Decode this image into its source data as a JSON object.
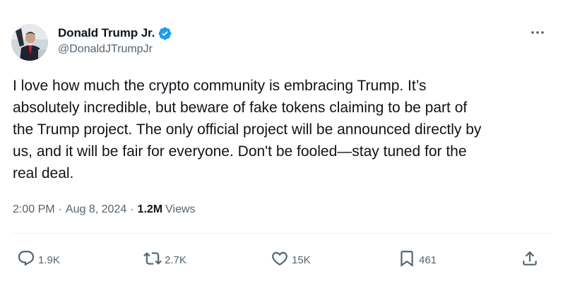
{
  "author": {
    "display_name": "Donald Trump Jr.",
    "handle": "@DonaldJTrumpJr",
    "verified_color": "#1d9bf0"
  },
  "tweet": {
    "text": "I love how much the crypto community is embracing Trump. It’s\nabsolutely incredible, but beware of fake tokens claiming to be part of\nthe Trump project. The only official project will be announced directly by\nus, and it will be fair for everyone. Don't be fooled—stay tuned for the\nreal deal."
  },
  "meta": {
    "time": "2:00 PM",
    "date": "Aug 8, 2024",
    "dot1": "·",
    "dot2": "·",
    "views_count": "1.2M",
    "views_label": "Views"
  },
  "actions": {
    "replies": "1.9K",
    "reposts": "2.7K",
    "likes": "15K",
    "bookmarks": "461"
  },
  "icons": {
    "verified": "verified-badge-icon",
    "more": "more-options-icon",
    "reply": "reply-icon",
    "repost": "repost-icon",
    "like": "heart-icon",
    "bookmark": "bookmark-icon",
    "share": "share-icon"
  },
  "colors": {
    "text": "#0f1419",
    "secondary": "#536471",
    "accent": "#1d9bf0"
  }
}
